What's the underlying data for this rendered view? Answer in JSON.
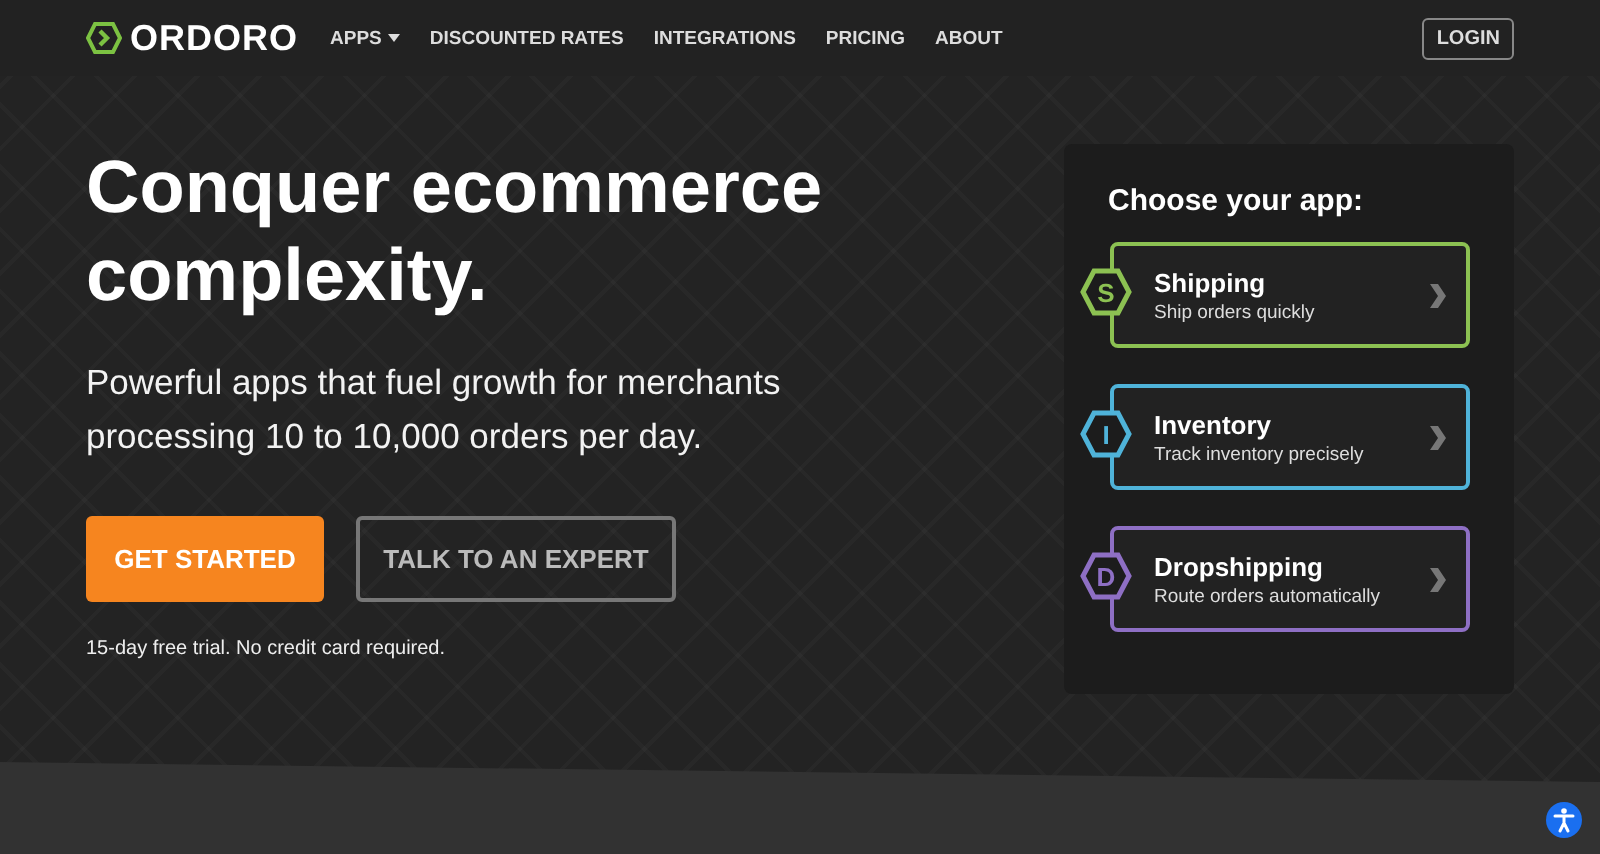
{
  "nav": {
    "logo": "ORDORO",
    "links": [
      {
        "label": "APPS",
        "dropdown": true
      },
      {
        "label": "DISCOUNTED RATES",
        "dropdown": false
      },
      {
        "label": "INTEGRATIONS",
        "dropdown": false
      },
      {
        "label": "PRICING",
        "dropdown": false
      },
      {
        "label": "ABOUT",
        "dropdown": false
      }
    ],
    "login": "LOGIN"
  },
  "hero": {
    "headline": "Conquer ecommerce complexity.",
    "subheadline": "Powerful apps that fuel growth for merchants processing 10 to 10,000 orders per day.",
    "primary_button": "GET STARTED",
    "secondary_button": "TALK TO AN EXPERT",
    "note": "15-day free trial. No credit card required."
  },
  "app_chooser": {
    "title": "Choose your app:",
    "apps": [
      {
        "letter": "S",
        "name": "Shipping",
        "description": "Ship orders quickly",
        "color": "#8cc152"
      },
      {
        "letter": "I",
        "name": "Inventory",
        "description": "Track inventory precisely",
        "color": "#4fb3d9"
      },
      {
        "letter": "D",
        "name": "Dropshipping",
        "description": "Route orders automatically",
        "color": "#8e6fc4"
      }
    ]
  }
}
